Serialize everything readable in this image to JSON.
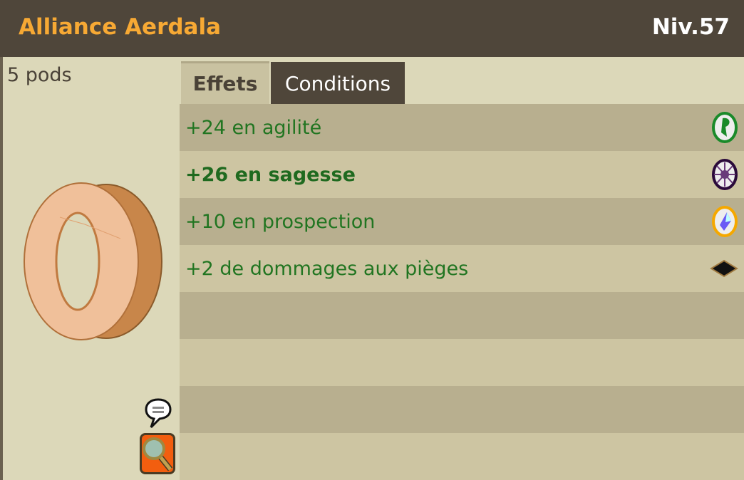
{
  "header": {
    "title": "Alliance Aerdala",
    "level": "Niv.57"
  },
  "item": {
    "weight": "5 pods"
  },
  "tabs": [
    {
      "label": "Effets",
      "active": true
    },
    {
      "label": "Conditions",
      "active": false
    }
  ],
  "effects": [
    {
      "text": "+24 en agilité",
      "icon": "agility-icon",
      "bold": false
    },
    {
      "text": "+26 en sagesse",
      "icon": "wisdom-icon",
      "bold": true
    },
    {
      "text": "+10 en prospection",
      "icon": "prospecting-icon",
      "bold": false
    },
    {
      "text": "+2 de dommages aux pièges",
      "icon": "trap-damage-icon",
      "bold": false
    }
  ],
  "colors": {
    "header": "#4f463a",
    "title": "#f7a934",
    "effect_text": "#217521"
  }
}
